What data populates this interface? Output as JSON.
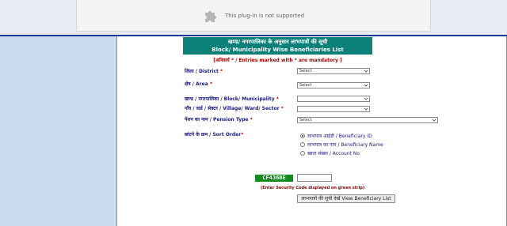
{
  "plugin": {
    "message": "This plug-in is not supported",
    "icon": "puzzle-piece-icon"
  },
  "header": {
    "title_hi": "खण्ड/ नगरपालिका के अनुसार लाभपात्रों की सूची",
    "title_en": "Block/ Municipality Wise Beneficiaries List"
  },
  "mandatory_note": {
    "open": "[अनिवार्य",
    "star": "*",
    "mid": " / Entries marked with ",
    "end": " are mandatory ]"
  },
  "form": {
    "district": {
      "label": "जिला / District",
      "required": "*",
      "value": "Select"
    },
    "area": {
      "label": "क्षेत्र / Area",
      "required": "*",
      "value": "Select"
    },
    "block": {
      "label": "खण्ड / नगरपालिका / Block/ Municipality",
      "required": "*",
      "value": ""
    },
    "village": {
      "label": "गाँव / वार्ड / सेक्टर / Village/ Ward/ Sector",
      "required": "*",
      "value": ""
    },
    "pension": {
      "label": "पेंशन का नाम / Pension Type",
      "required": "*",
      "value": "Select"
    },
    "sort": {
      "label": "छांटने के क्रम / Sort Order",
      "required": "*",
      "options": [
        {
          "label": "लाभपात्र आईडी / Beneficiary ID",
          "checked": true
        },
        {
          "label": "लाभपात्र का नाम / Beneficiary Name",
          "checked": false
        },
        {
          "label": "खाता संख्या / Account No",
          "checked": false
        }
      ]
    }
  },
  "captcha": {
    "code": "CF436BE",
    "input_value": "",
    "hint": "(Enter Security Code displayed on green strip)"
  },
  "submit_label": "लाभपात्रों की सूची देखें View Beneficiary List",
  "colors": {
    "header_bg": "#0b8078",
    "captcha_bg": "#118a1e",
    "left_panel": "#c9d9ee",
    "accent_line": "#1f3a93"
  }
}
